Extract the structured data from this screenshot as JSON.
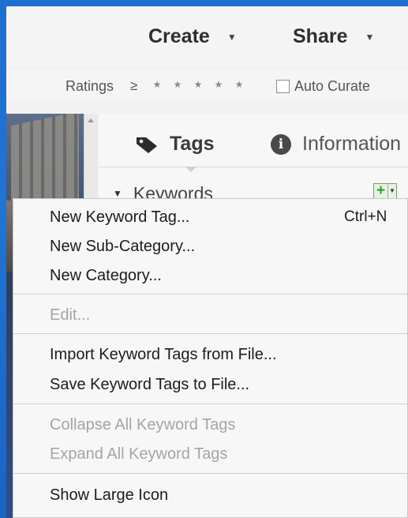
{
  "topbar": {
    "create_label": "Create",
    "share_label": "Share"
  },
  "ratings": {
    "label": "Ratings",
    "operator": "≥",
    "stars": [
      "★",
      "★",
      "★",
      "★",
      "★"
    ],
    "auto_curate_label": "Auto Curate",
    "auto_curate_checked": false
  },
  "panel": {
    "tabs": [
      {
        "label": "Tags",
        "icon": "tag-icon",
        "active": true
      },
      {
        "label": "Information",
        "icon": "info-icon",
        "active": false
      }
    ],
    "keywords_label": "Keywords",
    "add_button_icon": "plus-icon"
  },
  "menu": {
    "items": [
      {
        "label": "New Keyword Tag...",
        "shortcut": "Ctrl+N",
        "enabled": true
      },
      {
        "label": "New Sub-Category...",
        "enabled": true
      },
      {
        "label": "New Category...",
        "enabled": true
      },
      {
        "label": "Edit...",
        "enabled": false
      },
      {
        "label": "Import Keyword Tags from File...",
        "enabled": true
      },
      {
        "label": "Save Keyword Tags to File...",
        "enabled": true
      },
      {
        "label": "Collapse All Keyword Tags",
        "enabled": false
      },
      {
        "label": "Expand All Keyword Tags",
        "enabled": false
      },
      {
        "label": "Show Large Icon",
        "enabled": true
      }
    ]
  },
  "colors": {
    "accent_green": "#2aa12a",
    "desktop_blue": "#1f74d6",
    "disabled_text": "#a5a5a5"
  }
}
